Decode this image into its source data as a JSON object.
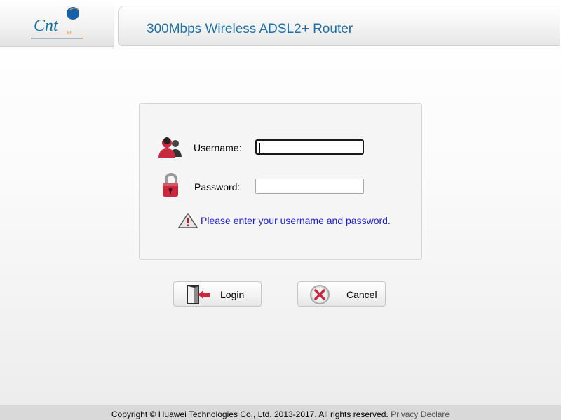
{
  "header": {
    "logo_name": "cnt-logo",
    "title": "300Mbps Wireless ADSL2+ Router"
  },
  "login": {
    "username_label": "Username:",
    "username_value": "",
    "password_label": "Password:",
    "password_value": "",
    "warning": "Please enter your username and password."
  },
  "buttons": {
    "login_label": "Login",
    "cancel_label": "Cancel"
  },
  "footer": {
    "copyright": "Copyright © Huawei Technologies Co., Ltd. 2013-2017. All rights reserved.",
    "privacy_label": "Privacy Declare"
  },
  "colors": {
    "title": "#1f6fa4",
    "warning_text": "#1d1dd6",
    "accent_red": "#c8293f"
  }
}
